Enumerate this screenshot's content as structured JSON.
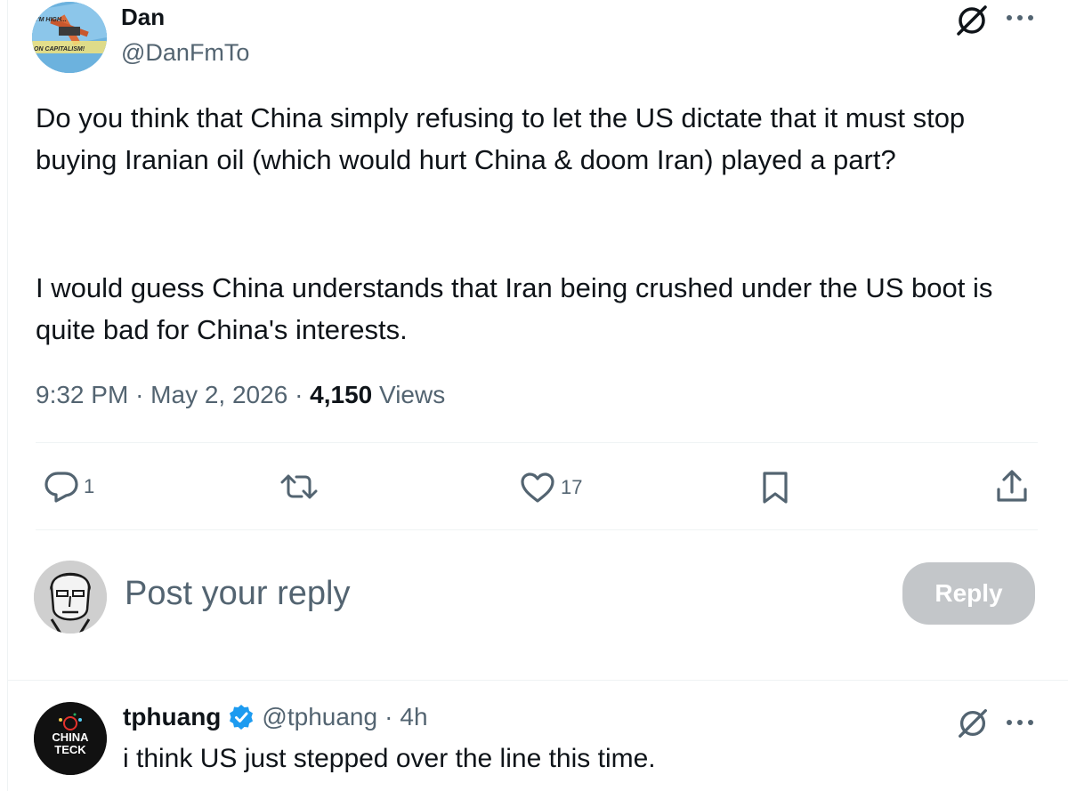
{
  "main_post": {
    "avatar_text_top": "I'M HIGH...",
    "avatar_text_bottom": "ON CAPITALISM!",
    "display_name": "Dan",
    "handle": "@DanFmTo",
    "paragraph_1": "Do you think that China simply refusing to let the US dictate that it must stop buying Iranian oil (which would hurt China & doom Iran) played a part?",
    "paragraph_2": "I would guess China understands that Iran being crushed under the US boot is quite bad for China's interests.",
    "time": "9:32 PM",
    "dot1": "·",
    "date": "May 2, 2026",
    "dot2": "·",
    "views_count": "4,150",
    "views_label": "Views"
  },
  "actions": {
    "reply_count": "1",
    "like_count": "17"
  },
  "composer": {
    "placeholder": "Post your reply",
    "reply_button": "Reply"
  },
  "reply_post": {
    "avatar_line1": "CHINA",
    "avatar_line2": "TECK",
    "display_name": "tphuang",
    "handle": "@tphuang",
    "dot": "·",
    "age": "4h",
    "text": "i think US just stepped over the line this time."
  },
  "icons": {
    "grok": "grok-icon",
    "more": "more-icon",
    "reply": "reply-icon",
    "repost": "repost-icon",
    "like": "heart-icon",
    "bookmark": "bookmark-icon",
    "share": "share-icon",
    "verified": "verified-badge-icon"
  },
  "colors": {
    "verified_blue": "#1d9bf0",
    "secondary_text": "#536471",
    "reply_button_disabled": "#c3c6c9"
  }
}
